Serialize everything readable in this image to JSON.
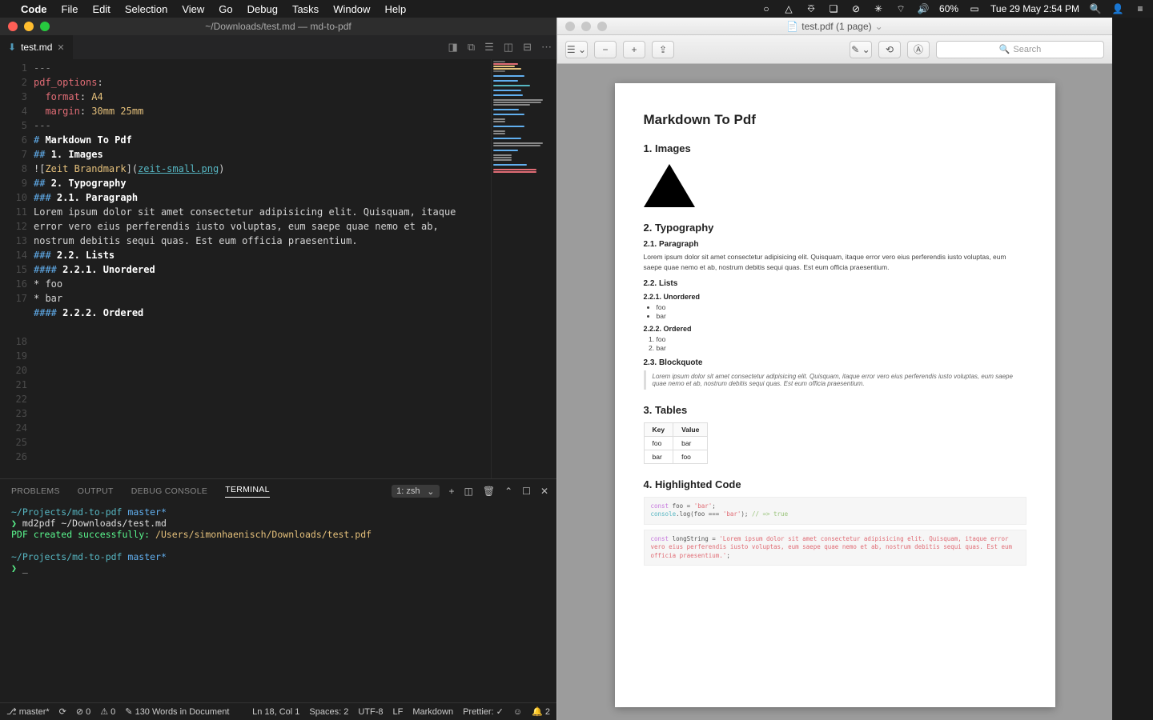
{
  "menubar": {
    "apple": "",
    "app_name": "Code",
    "items": [
      "File",
      "Edit",
      "Selection",
      "View",
      "Go",
      "Debug",
      "Tasks",
      "Window",
      "Help"
    ],
    "battery": "60%",
    "clock": "Tue 29 May  2:54 PM"
  },
  "vscode": {
    "title": "~/Downloads/test.md — md-to-pdf",
    "tab": {
      "name": "test.md"
    },
    "editor_lines": [
      {
        "n": 1,
        "segments": [
          {
            "cls": "c-gray",
            "t": "---"
          }
        ]
      },
      {
        "n": 2,
        "segments": [
          {
            "cls": "c-key",
            "t": "pdf_options"
          },
          {
            "cls": "c-white",
            "t": ":"
          }
        ]
      },
      {
        "n": 3,
        "segments": [
          {
            "cls": "c-white",
            "t": "  "
          },
          {
            "cls": "c-key",
            "t": "format"
          },
          {
            "cls": "c-white",
            "t": ": "
          },
          {
            "cls": "c-val",
            "t": "A4"
          }
        ]
      },
      {
        "n": 4,
        "segments": [
          {
            "cls": "c-white",
            "t": "  "
          },
          {
            "cls": "c-key",
            "t": "margin"
          },
          {
            "cls": "c-white",
            "t": ": "
          },
          {
            "cls": "c-val",
            "t": "30mm 25mm"
          }
        ]
      },
      {
        "n": 5,
        "segments": [
          {
            "cls": "c-gray",
            "t": "---"
          }
        ]
      },
      {
        "n": 6,
        "segments": [
          {
            "cls": "c-white",
            "t": ""
          }
        ]
      },
      {
        "n": 7,
        "segments": [
          {
            "cls": "c-blue",
            "t": "# "
          },
          {
            "cls": "c-bold",
            "t": "Markdown To Pdf"
          }
        ]
      },
      {
        "n": 8,
        "segments": [
          {
            "cls": "c-white",
            "t": ""
          }
        ]
      },
      {
        "n": 9,
        "segments": [
          {
            "cls": "c-blue",
            "t": "## "
          },
          {
            "cls": "c-bold",
            "t": "1. Images"
          }
        ]
      },
      {
        "n": 10,
        "segments": [
          {
            "cls": "c-white",
            "t": ""
          }
        ]
      },
      {
        "n": 11,
        "segments": [
          {
            "cls": "c-white",
            "t": "!["
          },
          {
            "cls": "c-val",
            "t": "Zeit Brandmark"
          },
          {
            "cls": "c-white",
            "t": "]("
          },
          {
            "cls": "c-cyan",
            "t": "zeit-small.png"
          },
          {
            "cls": "c-white",
            "t": ")"
          }
        ]
      },
      {
        "n": 12,
        "segments": [
          {
            "cls": "c-white",
            "t": ""
          }
        ]
      },
      {
        "n": 13,
        "segments": [
          {
            "cls": "c-blue",
            "t": "## "
          },
          {
            "cls": "c-bold",
            "t": "2. Typography"
          }
        ]
      },
      {
        "n": 14,
        "segments": [
          {
            "cls": "c-white",
            "t": ""
          }
        ]
      },
      {
        "n": 15,
        "segments": [
          {
            "cls": "c-blue",
            "t": "### "
          },
          {
            "cls": "c-bold",
            "t": "2.1. Paragraph"
          }
        ]
      },
      {
        "n": 16,
        "segments": [
          {
            "cls": "c-white",
            "t": ""
          }
        ]
      },
      {
        "n": 17,
        "segments": [
          {
            "cls": "c-white",
            "t": "Lorem ipsum dolor sit amet consectetur adipisicing elit. Quisquam, itaque\nerror vero eius perferendis iusto voluptas, eum saepe quae nemo et ab,\nnostrum debitis sequi quas. Est eum officia praesentium."
          }
        ]
      },
      {
        "n": 18,
        "segments": [
          {
            "cls": "c-white",
            "t": ""
          }
        ]
      },
      {
        "n": 19,
        "segments": [
          {
            "cls": "c-blue",
            "t": "### "
          },
          {
            "cls": "c-bold",
            "t": "2.2. Lists"
          }
        ]
      },
      {
        "n": 20,
        "segments": [
          {
            "cls": "c-white",
            "t": ""
          }
        ]
      },
      {
        "n": 21,
        "segments": [
          {
            "cls": "c-blue",
            "t": "#### "
          },
          {
            "cls": "c-bold",
            "t": "2.2.1. Unordered"
          }
        ]
      },
      {
        "n": 22,
        "segments": [
          {
            "cls": "c-white",
            "t": ""
          }
        ]
      },
      {
        "n": 23,
        "segments": [
          {
            "cls": "c-white",
            "t": "* foo"
          }
        ]
      },
      {
        "n": 24,
        "segments": [
          {
            "cls": "c-white",
            "t": "* bar"
          }
        ]
      },
      {
        "n": 25,
        "segments": [
          {
            "cls": "c-white",
            "t": ""
          }
        ]
      },
      {
        "n": 26,
        "segments": [
          {
            "cls": "c-blue",
            "t": "#### "
          },
          {
            "cls": "c-bold",
            "t": "2.2.2. Ordered"
          }
        ]
      }
    ],
    "panel_tabs": [
      "PROBLEMS",
      "OUTPUT",
      "DEBUG CONSOLE",
      "TERMINAL"
    ],
    "panel_tabs_active": "TERMINAL",
    "terminal_select": "1: zsh",
    "terminal": {
      "line1_path": "~/Projects/md-to-pdf",
      "line1_branch": "master*",
      "line2_prompt": "❯",
      "line2_cmd": "md2pdf ~/Downloads/test.md",
      "line3_msg": "PDF created successfully:",
      "line3_path": "/Users/simonhaenisch/Downloads/test.pdf",
      "line4_path": "~/Projects/md-to-pdf",
      "line4_branch": "master*",
      "line5_prompt": "❯",
      "cursor": "_"
    },
    "statusbar": {
      "branch": "master*",
      "errors": "⊘ 0",
      "warnings": "⚠ 0",
      "words": "✎ 130 Words in Document",
      "pos": "Ln 18, Col 1",
      "spaces": "Spaces: 2",
      "encoding": "UTF-8",
      "eol": "LF",
      "lang": "Markdown",
      "prettier": "Prettier: ✓",
      "bell": "🔔 2"
    }
  },
  "preview": {
    "title": "test.pdf (1 page)",
    "search_placeholder": "Search",
    "page": {
      "h1": "Markdown To Pdf",
      "s1": "1. Images",
      "s2": "2. Typography",
      "s21": "2.1. Paragraph",
      "p1": "Lorem ipsum dolor sit amet consectetur adipisicing elit. Quisquam, itaque error vero eius perferendis iusto voluptas, eum saepe quae nemo et ab, nostrum debitis sequi quas. Est eum officia praesentium.",
      "s22": "2.2. Lists",
      "s221": "2.2.1. Unordered",
      "ul": [
        "foo",
        "bar"
      ],
      "s222": "2.2.2. Ordered",
      "ol": [
        "foo",
        "bar"
      ],
      "s23": "2.3. Blockquote",
      "bq": "Lorem ipsum dolor sit amet consectetur adipisicing elit. Quisquam, itaque error vero eius perferendis iusto voluptas, eum saepe quae nemo et ab, nostrum debitis sequi quas. Est eum officia praesentium.",
      "s3": "3. Tables",
      "table": {
        "headers": [
          "Key",
          "Value"
        ],
        "rows": [
          [
            "foo",
            "bar"
          ],
          [
            "bar",
            "foo"
          ]
        ]
      },
      "s4": "4. Highlighted Code",
      "code1_kw": "const",
      "code1_rest": " foo = ",
      "code1_str": "'bar'",
      "code1_end": ";",
      "code1b": "console",
      "code1b_fn": ".log",
      "code1b_rest": "(foo === ",
      "code1b_str": "'bar'",
      "code1b_end": "); ",
      "code1b_cmt": "// => true",
      "code2_kw": "const",
      "code2_rest": " longString = ",
      "code2_str": "'Lorem ipsum dolor sit amet consectetur adipisicing elit. Quisquam, itaque error vero eius perferendis iusto voluptas, eum saepe quae nemo et ab, nostrum debitis sequi quas. Est eum officia praesentium.'",
      "code2_end": ";"
    }
  }
}
